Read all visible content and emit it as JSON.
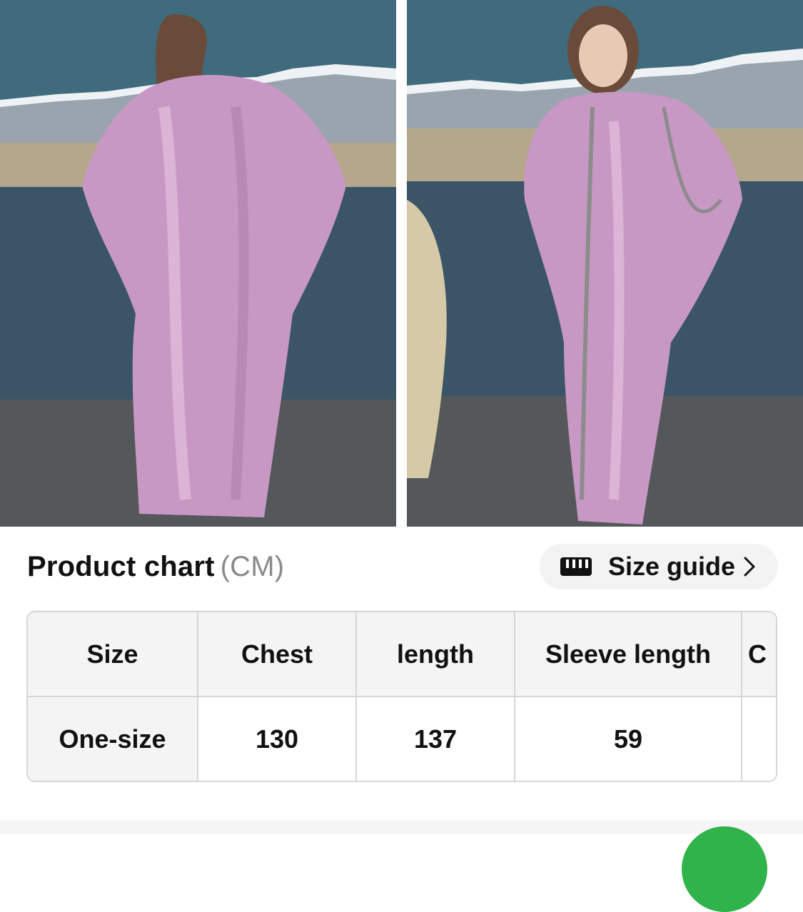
{
  "gallery": {
    "images": [
      {
        "name": "back-view"
      },
      {
        "name": "front-view"
      }
    ],
    "colors": {
      "sky": "#3f6b7d",
      "mountains": "#9aa4ae",
      "snow": "#eef2f5",
      "water": "#3b5566",
      "shore": "#55585a",
      "dress": "#c898c4"
    }
  },
  "chart": {
    "title": "Product chart",
    "unit": "(CM)",
    "size_guide": {
      "icon": "ruler-icon",
      "label": "Size guide",
      "chevron": "chevron-right-icon"
    }
  },
  "size_table": {
    "headers": [
      "Size",
      "Chest",
      "length",
      "Sleeve length",
      "C"
    ],
    "rows": [
      {
        "cells": [
          "One-size",
          "130",
          "137",
          "59",
          ""
        ]
      }
    ]
  },
  "colors": {
    "border": "#d6d6d6",
    "header_bg": "#f4f4f4",
    "pill_bg": "#f3f3f3",
    "muted_text": "#8a8a8a",
    "fab": "#2fb34a"
  }
}
